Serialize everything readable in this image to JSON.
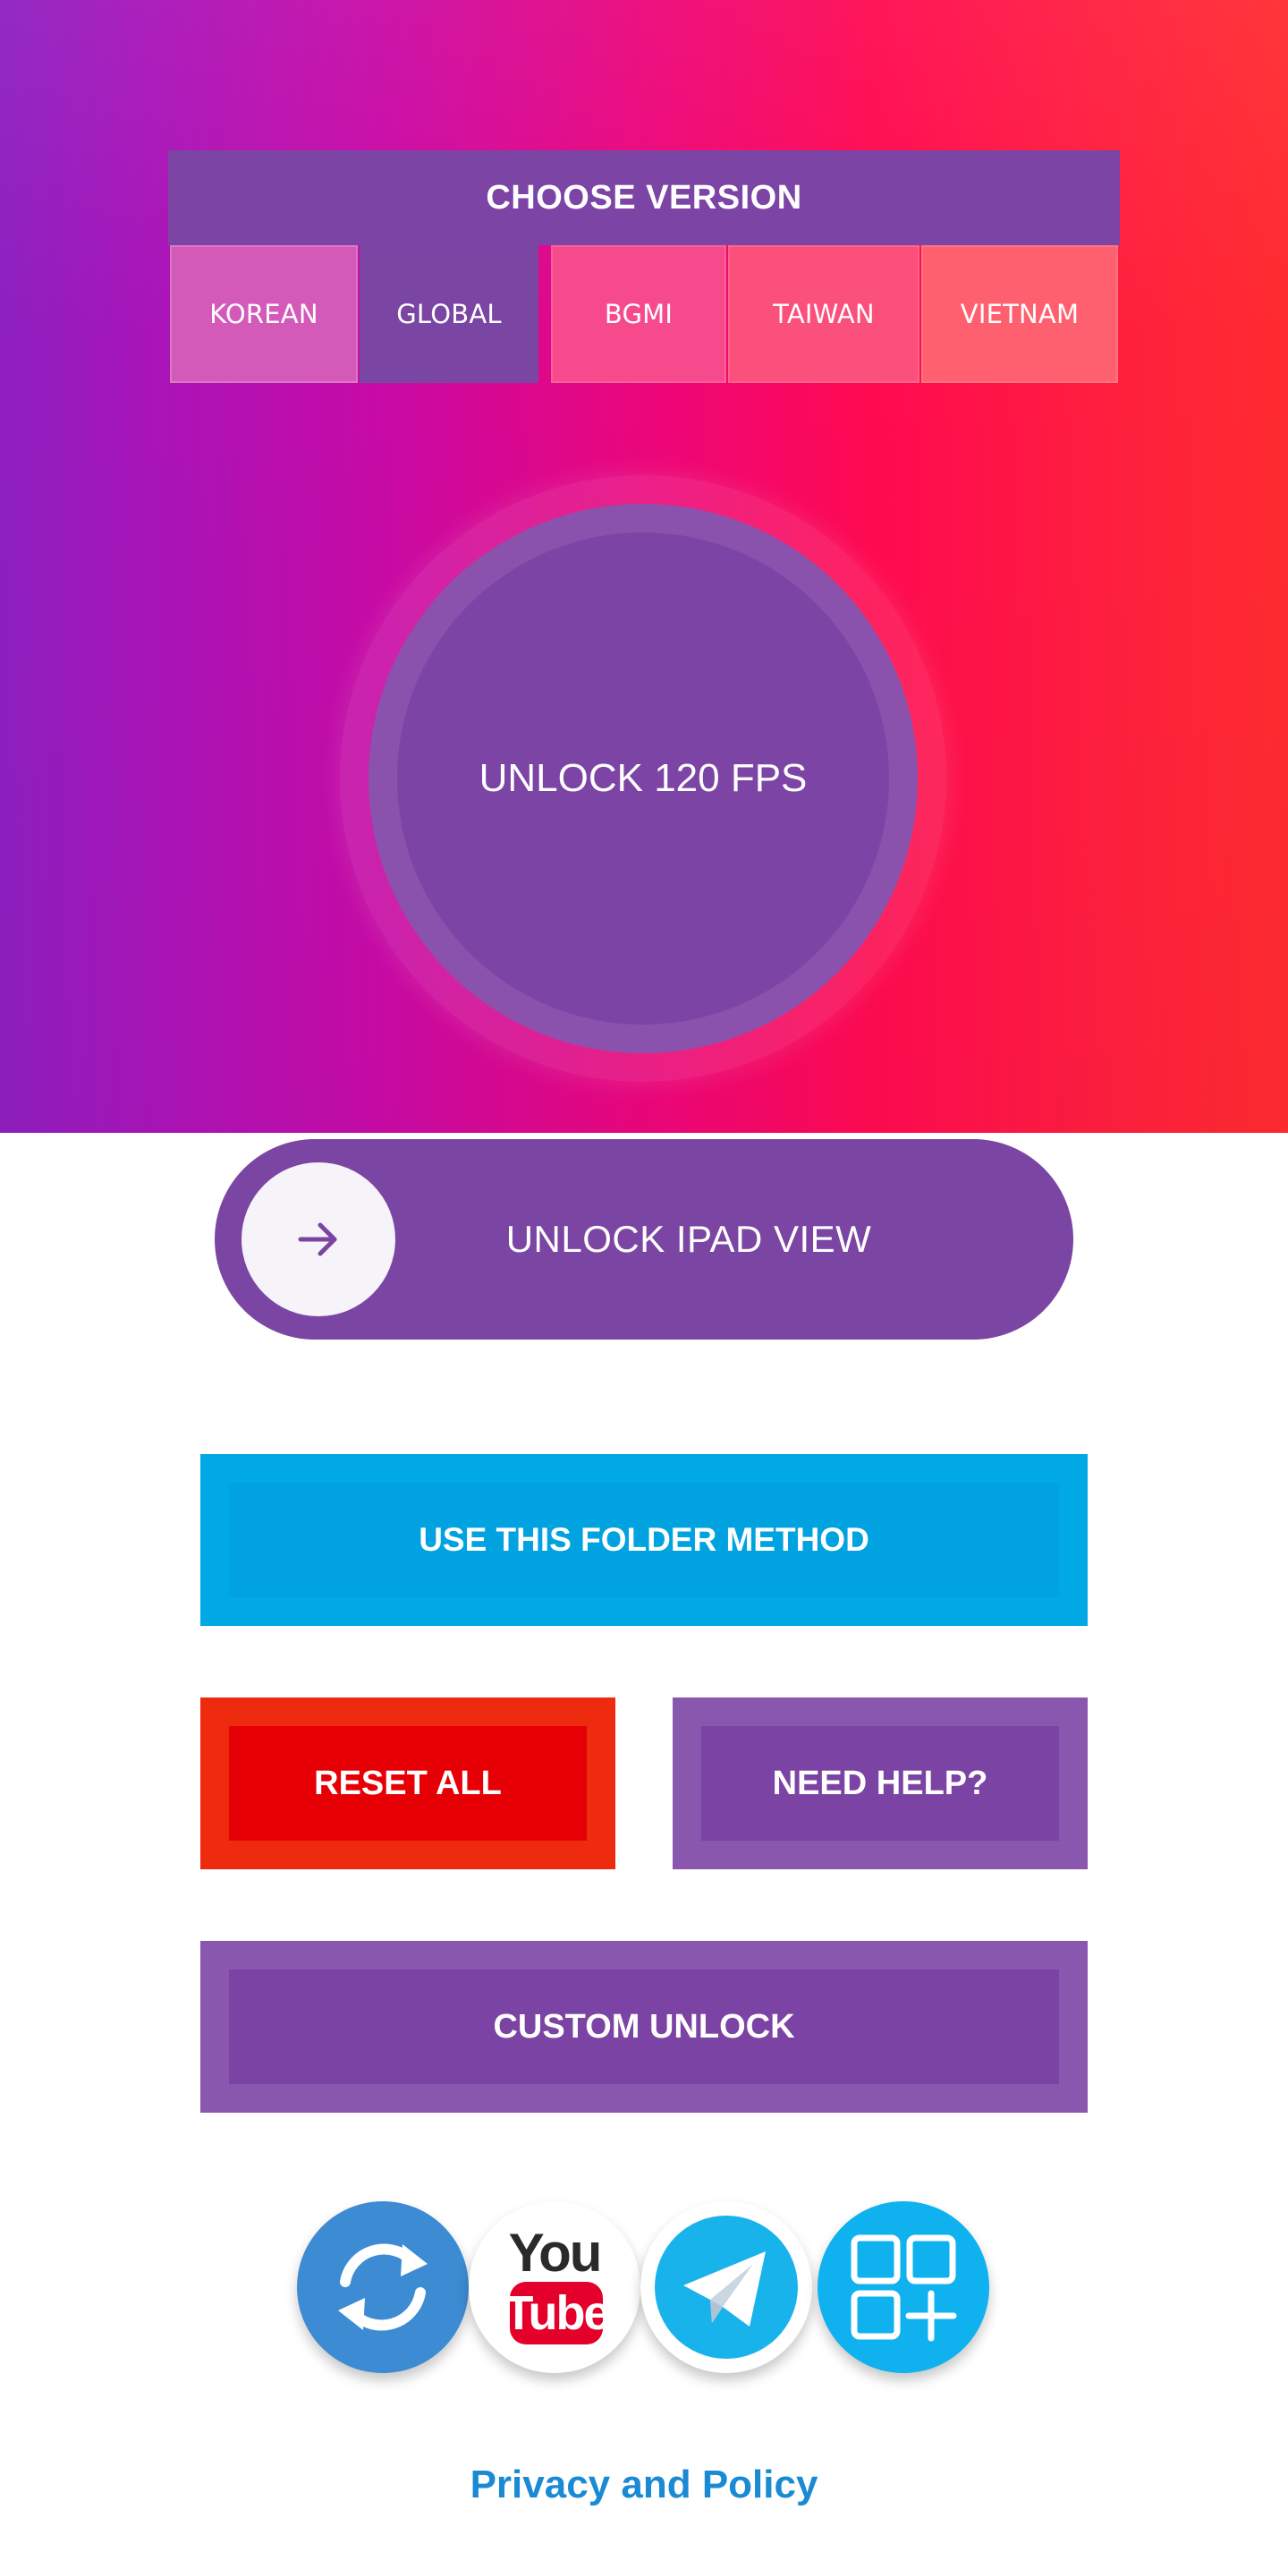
{
  "version_selector": {
    "title": "CHOOSE VERSION",
    "tabs": [
      {
        "label": "KOREAN"
      },
      {
        "label": "GLOBAL"
      },
      {
        "label": "BGMI"
      },
      {
        "label": "TAIWAN"
      },
      {
        "label": "VIETNAM"
      }
    ],
    "selected": "GLOBAL"
  },
  "fps_button": {
    "label": "UNLOCK 120 FPS"
  },
  "ipad_slider": {
    "label": "UNLOCK IPAD VIEW",
    "knob_icon": "arrow-right-icon"
  },
  "buttons": {
    "folder_method": "USE THIS FOLDER METHOD",
    "reset_all": "RESET ALL",
    "need_help": "NEED HELP?",
    "custom_unlock": "CUSTOM UNLOCK"
  },
  "social": {
    "items": [
      {
        "icon": "refresh-icon"
      },
      {
        "icon": "youtube-icon",
        "you": "You",
        "tube": "Tube"
      },
      {
        "icon": "telegram-icon"
      },
      {
        "icon": "apps-grid-icon"
      }
    ]
  },
  "footer": {
    "privacy_link": "Privacy and Policy"
  },
  "colors": {
    "purple": "#7b44a3",
    "blue": "#00a9e5",
    "red": "#e60005",
    "link": "#1a8ad4"
  }
}
